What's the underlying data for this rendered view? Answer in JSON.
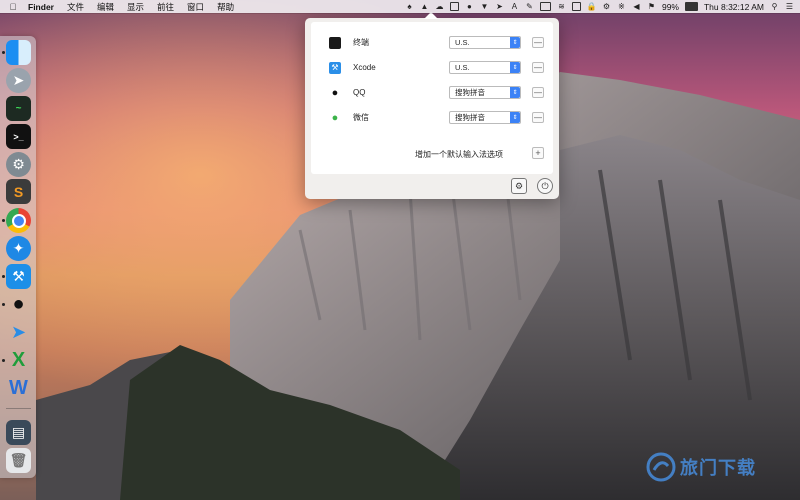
{
  "menubar": {
    "apple_icon": "apple-logo-icon",
    "items": [
      "Finder",
      "文件",
      "编辑",
      "显示",
      "前往",
      "窗口",
      "帮助"
    ],
    "status_icons": [
      "input-source-icon",
      "ghost-icon",
      "cloud-icon",
      "square-icon",
      "qq-icon",
      "bird-icon",
      "send-icon",
      "adobe-icon",
      "pen-icon",
      "battery-ext-icon",
      "wifi-icon",
      "airplay-icon",
      "lock-icon",
      "gear-icon",
      "bluetooth-icon",
      "speaker-icon",
      "flag-icon"
    ],
    "battery": "99%",
    "clock": "Thu 8:32:12 AM",
    "search_icon": "search-icon",
    "list_icon": "list-icon"
  },
  "dock": {
    "apps": [
      "finder",
      "launchpad",
      "activity-monitor",
      "terminal",
      "system-preferences",
      "sublime-text",
      "chrome",
      "safari",
      "xcode",
      "qq",
      "paper-plane",
      "excel",
      "word",
      "downloads",
      "trash"
    ]
  },
  "panel": {
    "rows": [
      {
        "app": "终端",
        "icon": "terminal-icon",
        "input": "U.S."
      },
      {
        "app": "Xcode",
        "icon": "xcode-icon",
        "input": "U.S."
      },
      {
        "app": "QQ",
        "icon": "qq-icon",
        "input": "搜狗拼音"
      },
      {
        "app": "微信",
        "icon": "wechat-icon",
        "input": "搜狗拼音"
      }
    ],
    "add_label": "增加一个默认输入法选项",
    "minus_glyph": "—",
    "plus_glyph": "+"
  },
  "watermark": {
    "text": "旅门下载"
  },
  "colors": {
    "accent": "#3b82f6"
  }
}
